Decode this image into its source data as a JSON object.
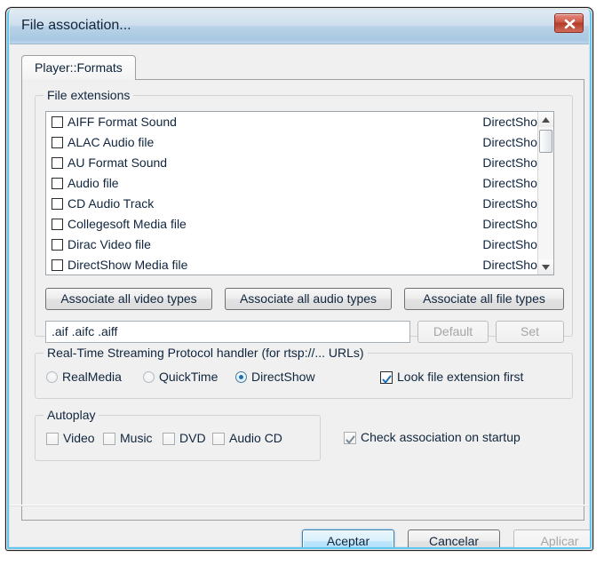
{
  "window": {
    "title": "File association...",
    "close_icon": "close-x-icon"
  },
  "tabs": [
    {
      "label": "Player::Formats",
      "selected": true
    }
  ],
  "file_extensions": {
    "group_label": "File extensions",
    "rows": [
      {
        "name": "AIFF Format Sound",
        "handler": "DirectShow",
        "checked": false
      },
      {
        "name": "ALAC Audio file",
        "handler": "DirectShow",
        "checked": false
      },
      {
        "name": "AU Format Sound",
        "handler": "DirectShow",
        "checked": false
      },
      {
        "name": "Audio file",
        "handler": "DirectShow",
        "checked": false
      },
      {
        "name": "CD Audio Track",
        "handler": "DirectShow",
        "checked": false
      },
      {
        "name": "Collegesoft Media file",
        "handler": "DirectShow",
        "checked": false
      },
      {
        "name": "Dirac Video file",
        "handler": "DirectShow",
        "checked": false
      },
      {
        "name": "DirectShow Media file",
        "handler": "DirectShow",
        "checked": false
      }
    ],
    "scrollbar": {
      "up_icon": "scroll-up-arrow-icon",
      "down_icon": "scroll-down-arrow-icon"
    },
    "associate_buttons": [
      {
        "label": "Associate all video types",
        "disabled": false
      },
      {
        "label": "Associate all audio types",
        "disabled": false
      },
      {
        "label": "Associate all file types",
        "disabled": false
      }
    ],
    "extension_value": ".aif .aifc .aiff",
    "extension_placeholder": "",
    "default_button": {
      "label": "Default",
      "disabled": true
    },
    "set_button": {
      "label": "Set",
      "disabled": true
    }
  },
  "rtsp": {
    "group_label": "Real-Time Streaming Protocol handler (for rtsp://... URLs)",
    "options": [
      {
        "label": "RealMedia",
        "checked": false,
        "disabled": true
      },
      {
        "label": "QuickTime",
        "checked": false,
        "disabled": true
      },
      {
        "label": "DirectShow",
        "checked": true,
        "disabled": false
      }
    ],
    "look_extension_first": {
      "label": "Look file extension first",
      "checked": true,
      "disabled": false
    }
  },
  "autoplay": {
    "group_label": "Autoplay",
    "items": [
      {
        "label": "Video",
        "checked": false,
        "disabled": true
      },
      {
        "label": "Music",
        "checked": false,
        "disabled": true
      },
      {
        "label": "DVD",
        "checked": false,
        "disabled": true
      },
      {
        "label": "Audio CD",
        "checked": false,
        "disabled": true
      }
    ],
    "check_on_startup": {
      "label": "Check association on startup",
      "checked": true,
      "disabled": true
    }
  },
  "footer": {
    "accept": {
      "label": "Aceptar",
      "disabled": false,
      "default": true
    },
    "cancel": {
      "label": "Cancelar",
      "disabled": false,
      "default": false
    },
    "apply": {
      "label": "Aplicar",
      "disabled": true,
      "default": false
    }
  },
  "colors": {
    "accent": "#1a70b8",
    "close_red": "#b53c2a",
    "aero_border": "#5fc7ef",
    "dialog_bg": "#f0f0f0"
  }
}
